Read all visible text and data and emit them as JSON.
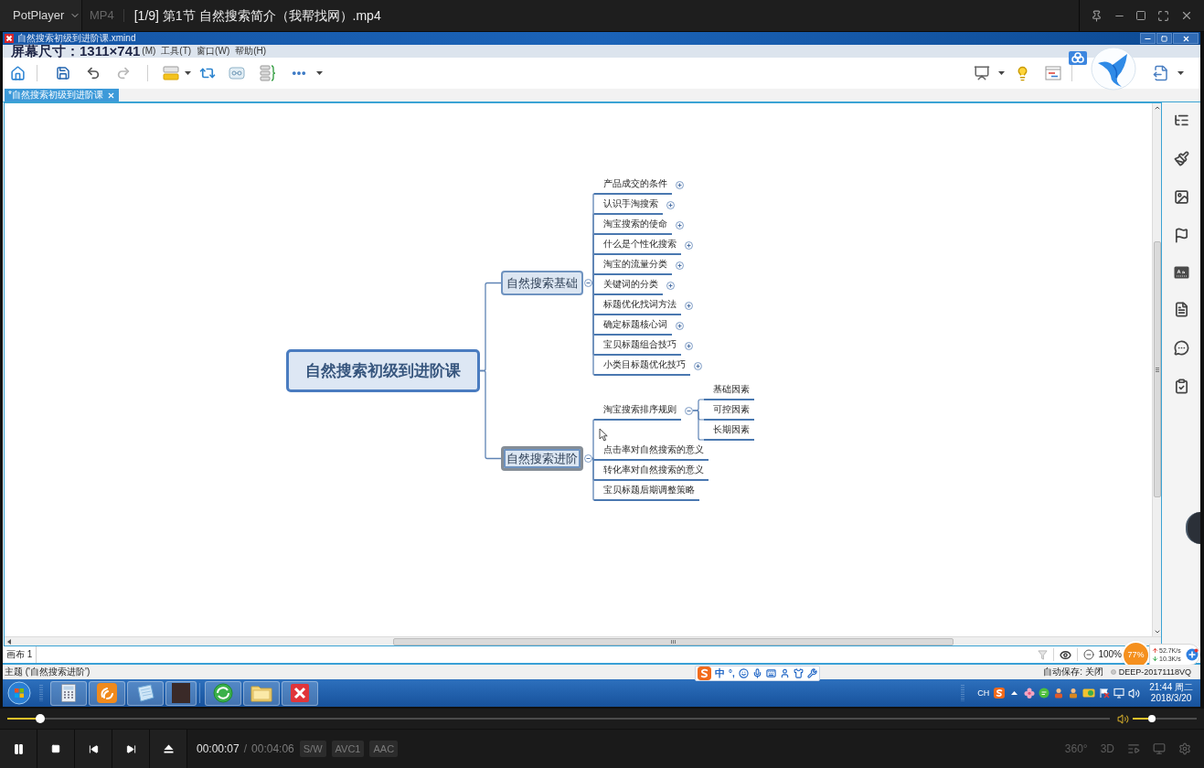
{
  "player": {
    "menu_button": "PotPlayer",
    "format": "MP4",
    "title": "[1/9] 第1节 自然搜索简介（我帮找网）.mp4"
  },
  "xmind": {
    "title": "自然搜索初级到进阶课.xmind",
    "screen_overlay": "屏幕尺寸：1311×741",
    "menu": [
      "(M)",
      "工具(T)",
      "窗口(W)",
      "帮助(H)"
    ],
    "document_tabs": [
      {
        "label": "*自然搜索初级到进阶课",
        "selected": true
      }
    ],
    "map": {
      "root": "自然搜索初级到进阶课",
      "branches": [
        {
          "label": "自然搜索基础",
          "selected": false,
          "expanded": true,
          "children": [
            {
              "label": "产品成交的条件",
              "expanded": false
            },
            {
              "label": "认识手淘搜索",
              "expanded": false
            },
            {
              "label": "淘宝搜索的使命",
              "expanded": false
            },
            {
              "label": "什么是个性化搜索",
              "expanded": false
            },
            {
              "label": "淘宝的流量分类",
              "expanded": false
            },
            {
              "label": "关键词的分类",
              "expanded": false
            },
            {
              "label": "标题优化找词方法",
              "expanded": false
            },
            {
              "label": "确定标题核心词",
              "expanded": false
            },
            {
              "label": "宝贝标题组合技巧",
              "expanded": false
            },
            {
              "label": "小类目标题优化技巧",
              "expanded": false
            }
          ]
        },
        {
          "label": "自然搜索进阶",
          "selected": true,
          "expanded": true,
          "children": [
            {
              "label": "淘宝搜索排序规则",
              "expanded": true,
              "children": [
                {
                  "label": "基础因素"
                },
                {
                  "label": "可控因素"
                },
                {
                  "label": "长期因素"
                }
              ]
            },
            {
              "label": "点击率对自然搜索的意义"
            },
            {
              "label": "转化率对自然搜索的意义"
            },
            {
              "label": "宝贝标题后期调整策略"
            }
          ]
        }
      ]
    },
    "sheet_tabs": [
      {
        "label": "画布 1",
        "selected": true
      }
    ],
    "zoom": "100%",
    "status": "主题 ('自然搜索进阶')",
    "autosave": "自动保存: 关闭",
    "computer": "DEEP-20171118VQ"
  },
  "widgets": {
    "ime_mode": "中",
    "ime_punctuation": "°,",
    "usage": "77%",
    "upload": "52.7K/s",
    "download": "10.3K/s"
  },
  "taskbar": {
    "language": "CH",
    "time": "21:44 周二",
    "date": "2018/3/20"
  },
  "playback": {
    "playing": true,
    "seek": {
      "level": 0.03
    },
    "volume": {
      "level": 0.3
    },
    "elapsed": "00:00:07",
    "separator": "/",
    "duration": "00:04:06",
    "badges": [
      "S/W",
      "AVC1",
      "AAC"
    ],
    "modes": [
      "360°",
      "3D"
    ]
  }
}
